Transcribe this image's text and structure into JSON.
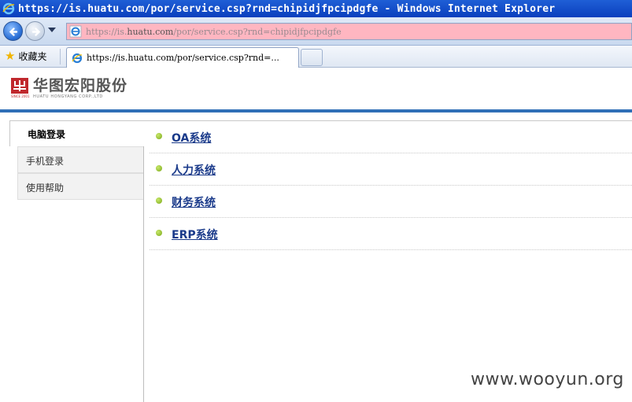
{
  "window": {
    "title": "https://is.huatu.com/por/service.csp?rnd=chipidjfpcipdgfe - Windows Internet Explorer"
  },
  "address_bar": {
    "prefix": "https://is.",
    "host": "huatu.com",
    "suffix": "/por/service.csp?rnd=chipidjfpcipdgfe"
  },
  "favorites": {
    "label": "收藏夹"
  },
  "tab": {
    "title": "https://is.huatu.com/por/service.csp?rnd=..."
  },
  "logo": {
    "name": "华图宏阳股份",
    "tagline": "HUATU HONGYANG CORP.,LTD",
    "mark_text": "SINCE 2001"
  },
  "sidebar": {
    "active": "电脑登录",
    "items": [
      {
        "label": "手机登录"
      },
      {
        "label": "使用帮助"
      }
    ]
  },
  "systems": [
    {
      "label": "OA系统"
    },
    {
      "label": "人力系统"
    },
    {
      "label": "财务系统"
    },
    {
      "label": "ERP系统"
    }
  ],
  "watermark": "www.wooyun.org",
  "colors": {
    "title_bar": "#0a3fbd",
    "address_bar_bg": "#ffb6c1",
    "accent_rule": "#2f6fb7",
    "link": "#1a3a8a",
    "logo_red": "#c0282d"
  }
}
